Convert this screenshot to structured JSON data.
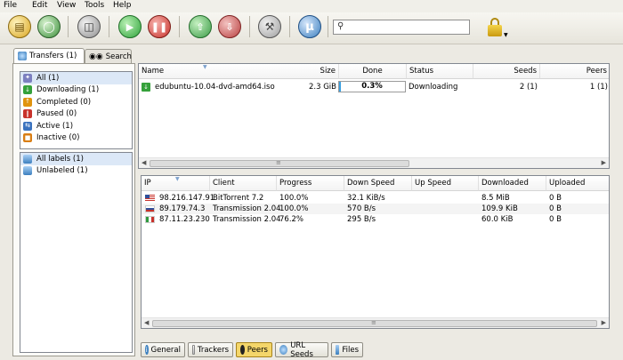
{
  "menu": [
    "File",
    "Edit",
    "View",
    "Tools",
    "Help"
  ],
  "toolbar": {
    "search_placeholder": "",
    "buttons": [
      "open-torrent",
      "open-url",
      "remove",
      "start",
      "pause",
      "queue-up",
      "queue-down",
      "preferences",
      "about"
    ],
    "colors": {
      "start": "#2fa33a",
      "pause": "#c8322b",
      "accent": "#3b7fbf"
    }
  },
  "tabs": {
    "transfers": "Transfers (1)",
    "search": "Search"
  },
  "filters": [
    {
      "label": "All (1)",
      "color": "#7b7fbf",
      "glyph": "✦",
      "selected": true
    },
    {
      "label": "Downloading (1)",
      "color": "#35a13b",
      "glyph": "↓"
    },
    {
      "label": "Completed (0)",
      "color": "#e0930f",
      "glyph": "↑"
    },
    {
      "label": "Paused (0)",
      "color": "#c8322b",
      "glyph": "‖"
    },
    {
      "label": "Active (1)",
      "color": "#3b73bf",
      "glyph": "⇆"
    },
    {
      "label": "Inactive (0)",
      "color": "#d97e15",
      "glyph": "■"
    }
  ],
  "labels": [
    {
      "label": "All labels (1)",
      "selected": true
    },
    {
      "label": "Unlabeled (1)"
    }
  ],
  "torrent_columns": {
    "name": "Name",
    "size": "Size",
    "done": "Done",
    "status": "Status",
    "seeds": "Seeds",
    "peers": "Peers"
  },
  "torrents": [
    {
      "name": "edubuntu-10.04-dvd-amd64.iso",
      "size": "2.3 GiB",
      "done": "0.3%",
      "progress": 0.003,
      "status": "Downloading",
      "seeds": "2 (1)",
      "peers": "1 (1)"
    }
  ],
  "peer_columns": {
    "ip": "IP",
    "client": "Client",
    "progress": "Progress",
    "down_speed": "Down Speed",
    "up_speed": "Up Speed",
    "downloaded": "Downloaded",
    "uploaded": "Uploaded"
  },
  "peers": [
    {
      "flag": "us",
      "ip": "98.216.147.91",
      "client": "BitTorrent 7.2",
      "progress": "100.0%",
      "down_speed": "32.1 KiB/s",
      "up_speed": "",
      "downloaded": "8.5 MiB",
      "uploaded": "0 B"
    },
    {
      "flag": "ru",
      "ip": "89.179.74.3",
      "client": "Transmission 2.04",
      "progress": "100.0%",
      "down_speed": "570 B/s",
      "up_speed": "",
      "downloaded": "109.9 KiB",
      "uploaded": "0 B"
    },
    {
      "flag": "it",
      "ip": "87.11.23.230",
      "client": "Transmission 2.04",
      "progress": "76.2%",
      "down_speed": "295 B/s",
      "up_speed": "",
      "downloaded": "60.0 KiB",
      "uploaded": "0 B"
    }
  ],
  "bottom_tabs": {
    "general": "General",
    "trackers": "Trackers",
    "peers": "Peers",
    "url_seeds": "URL Seeds",
    "files": "Files",
    "active": "peers"
  }
}
